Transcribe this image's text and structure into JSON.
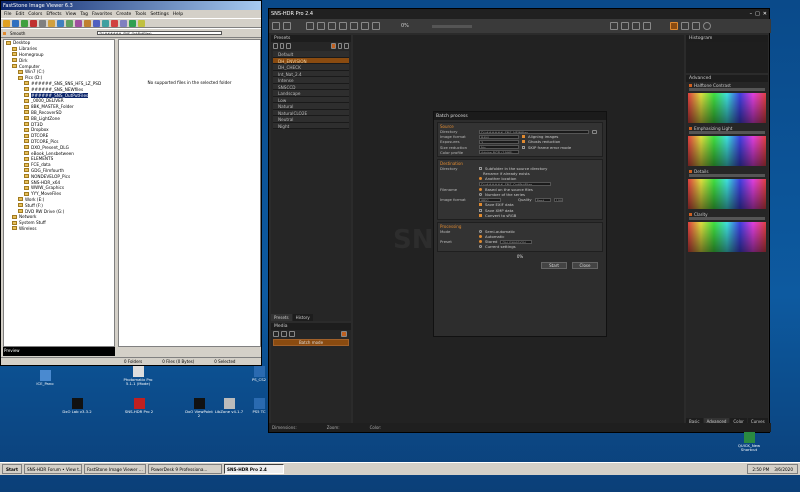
{
  "faststone": {
    "title": "FastStone Image Viewer 6.3",
    "menu": [
      "File",
      "Edit",
      "Colors",
      "Effects",
      "View",
      "Tag",
      "Favorites",
      "Create",
      "Tools",
      "Settings",
      "Help"
    ],
    "smooth_label": "Smooth",
    "path_value": "D:\\######_SNS_OutPutFiles\\",
    "empty_message": "No supported files in the selected folder",
    "tree": [
      {
        "label": "Desktop",
        "indent": 0
      },
      {
        "label": "Libraries",
        "indent": 1
      },
      {
        "label": "Homegroup",
        "indent": 1
      },
      {
        "label": "Dirk",
        "indent": 1
      },
      {
        "label": "Computer",
        "indent": 1
      },
      {
        "label": "Win7 (C:)",
        "indent": 2
      },
      {
        "label": "Pics (D:)",
        "indent": 2
      },
      {
        "label": "######_SNS_SNS_HFS_LZ_PSD",
        "indent": 3
      },
      {
        "label": "######_SNS_NEWfiles",
        "indent": 3
      },
      {
        "label": "######_SNS_OutPutFiles",
        "indent": 3,
        "selected": true
      },
      {
        "label": "_0000_DELIVER",
        "indent": 3
      },
      {
        "label": "8BK_MASTER_Folder",
        "indent": 3
      },
      {
        "label": "BB_RecoverSD",
        "indent": 3
      },
      {
        "label": "BB_LightZone",
        "indent": 3
      },
      {
        "label": "DT3D",
        "indent": 3
      },
      {
        "label": "Dropbox",
        "indent": 3
      },
      {
        "label": "DTCORE",
        "indent": 3
      },
      {
        "label": "DTCORE_Pics",
        "indent": 3
      },
      {
        "label": "DXO_Present_DLG",
        "indent": 3
      },
      {
        "label": "eBook_Lensbetween",
        "indent": 3
      },
      {
        "label": "ELEMENTS",
        "indent": 3
      },
      {
        "label": "FCE_data",
        "indent": 3
      },
      {
        "label": "GDG_Filmfourth",
        "indent": 3
      },
      {
        "label": "NONDEVELOP_Pics",
        "indent": 3
      },
      {
        "label": "SNS-HDR_x64",
        "indent": 3
      },
      {
        "label": "WWW_Graphics",
        "indent": 3
      },
      {
        "label": "YYY_MoveFiles",
        "indent": 3
      },
      {
        "label": "Work (E:)",
        "indent": 2
      },
      {
        "label": "Stuff (F:)",
        "indent": 2
      },
      {
        "label": "DVD RW Drive (G:)",
        "indent": 2
      },
      {
        "label": "Network",
        "indent": 1
      },
      {
        "label": "System Stuff",
        "indent": 1
      },
      {
        "label": "Wireless",
        "indent": 1
      }
    ],
    "preview_label": "Preview",
    "status": [
      "0 Folders",
      "0 Files (0 Bytes)",
      "0 Selected"
    ]
  },
  "sns": {
    "title": "SNS-HDR Pro 2.4",
    "zoom": "0%",
    "presets_header": "Presets",
    "presets": [
      {
        "label": "Default",
        "style": "dark"
      },
      {
        "label": "DH_ENVISION",
        "style": "orange"
      },
      {
        "label": "DH_CHECK",
        "style": "dark"
      },
      {
        "label": "Int_Nat_2.4",
        "style": "dark"
      },
      {
        "label": "Intense",
        "style": "dark"
      },
      {
        "label": "SNSCCD",
        "style": "dark"
      },
      {
        "label": "Landscape",
        "style": "dark"
      },
      {
        "label": "Low",
        "style": "dark"
      },
      {
        "label": "Natural",
        "style": "dark"
      },
      {
        "label": "NaturalCLO2E",
        "style": "dark"
      },
      {
        "label": "Neutral",
        "style": "dark"
      },
      {
        "label": "Night",
        "style": "dark"
      }
    ],
    "tabs": [
      "Presets",
      "History"
    ],
    "media_header": "Media",
    "batch_button": "Batch mode",
    "histogram_header": "Histogram",
    "advanced_header": "Advanced",
    "adjustments": [
      "Halftone Contrast",
      "Emphasizing Light",
      "Details",
      "Clarity"
    ],
    "bottom_tabs": [
      "Basic",
      "Advanced",
      "Color",
      "Curves"
    ],
    "status": [
      "Dimensions:",
      "Zoom:",
      "Color:"
    ],
    "watermark": "SNS-HDR Pro"
  },
  "batch": {
    "title": "Batch process",
    "source_header": "Source",
    "directory_label": "Directory",
    "directory_value": "D:\\######_SNS_NEWfiles",
    "image_format_label": "Image format",
    "image_format_value": "RAW",
    "align_label": "Aligning images",
    "exposures_label": "Exposures",
    "exposures_value": "3",
    "ghost_label": "Ghosts reduction",
    "size_label": "Size reduction",
    "size_value": "No",
    "skip_label": "SKIP frame error mode",
    "color_profile_label": "Color profile",
    "color_profile_value": "Adobe RGB (1998)",
    "dest_header": "Destination",
    "dest_dir_label": "Directory",
    "dest_subfolder": "Subfolder in the source directory",
    "rename_label": "Rename if already exists",
    "another_label": "Another location",
    "dest_dir_value": "D:\\######_SNS_OutPutFiles",
    "filename_label": "Filename",
    "fn_opt1": "Based on the source files",
    "fn_opt2": "Number of the series",
    "out_format_label": "Image format",
    "out_format_value": "JPEG",
    "quality_label": "Quality",
    "quality_value": "Best",
    "quality_num": "100",
    "save_exif": "Save EXIF data",
    "save_iptc": "Save XMP data",
    "convert_srgb": "Convert to sRGB",
    "processing_header": "Processing",
    "mode_label": "Mode",
    "mode_semi": "Semi-automatic",
    "mode_auto": "Automatic",
    "preset_label": "Preset",
    "preset_opt": "Stored",
    "preset_value": "DH_ENVISION",
    "current_settings": "Current settings",
    "progress": "0%",
    "start_label": "Start",
    "close_label": "Close"
  },
  "desktop_icons": [
    {
      "label": "ICE_Pano"
    },
    {
      "label": "Photomatix Pro 5.1.1 (Mode)"
    },
    {
      "label": "PS_CS2"
    },
    {
      "label": "DxO Lab v3.3.2"
    },
    {
      "label": "SNS-HDR Pro 2"
    },
    {
      "label": "DxO ViewPoint 2"
    },
    {
      "label": "LibZone v4.1.7"
    },
    {
      "label": "PS5 TC"
    },
    {
      "label": "QUICK_New Shortcut"
    }
  ],
  "taskbar": {
    "start": "Start",
    "tasks": [
      "SNS-HDR Forum • View t...",
      "FastStone Image Viewer ...",
      "PowerDesk 9 Professiona...",
      "SNS-HDR Pro 2.4"
    ],
    "time": "2:50 PM",
    "date": "3/6/2020"
  }
}
